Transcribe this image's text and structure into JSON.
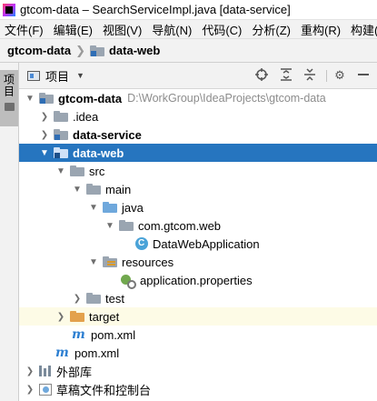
{
  "window": {
    "title": "gtcom-data – SearchServiceImpl.java [data-service]"
  },
  "menu": [
    "文件(F)",
    "编辑(E)",
    "视图(V)",
    "导航(N)",
    "代码(C)",
    "分析(Z)",
    "重构(R)",
    "构建(B)"
  ],
  "breadcrumb": {
    "root": "gtcom-data",
    "module": "data-web"
  },
  "side_tab": {
    "label": "项目"
  },
  "panel": {
    "title": "项目",
    "buttons": [
      "locate-icon",
      "expand-all-icon",
      "collapse-all-icon",
      "gear-icon",
      "hide-icon"
    ]
  },
  "tree": [
    {
      "label": "gtcom-data",
      "path": "D:\\WorkGroup\\IdeaProjects\\gtcom-data",
      "icon": "module-folder-icon",
      "arrow": "down",
      "bold": true
    },
    {
      "label": ".idea",
      "icon": "folder-icon",
      "arrow": "right"
    },
    {
      "label": "data-service",
      "icon": "module-folder-icon",
      "arrow": "right",
      "bold": true
    },
    {
      "label": "data-web",
      "icon": "module-folder-icon",
      "arrow": "down",
      "bold": true,
      "selected": true
    },
    {
      "label": "src",
      "icon": "folder-icon",
      "arrow": "down"
    },
    {
      "label": "main",
      "icon": "folder-icon",
      "arrow": "down"
    },
    {
      "label": "java",
      "icon": "source-folder-icon",
      "arrow": "down"
    },
    {
      "label": "com.gtcom.web",
      "icon": "package-icon",
      "arrow": "down"
    },
    {
      "label": "DataWebApplication",
      "icon": "spring-class-icon"
    },
    {
      "label": "resources",
      "icon": "resources-folder-icon",
      "arrow": "down"
    },
    {
      "label": "application.properties",
      "icon": "properties-file-icon"
    },
    {
      "label": "test",
      "icon": "folder-icon",
      "arrow": "right"
    },
    {
      "label": "target",
      "icon": "excluded-folder-icon",
      "arrow": "right"
    },
    {
      "label": "pom.xml",
      "icon": "maven-icon"
    },
    {
      "label": "pom.xml",
      "icon": "maven-icon"
    },
    {
      "label": "外部库",
      "icon": "external-libraries-icon",
      "arrow": "right"
    },
    {
      "label": "草稿文件和控制台",
      "icon": "scratches-icon",
      "arrow": "right"
    }
  ]
}
